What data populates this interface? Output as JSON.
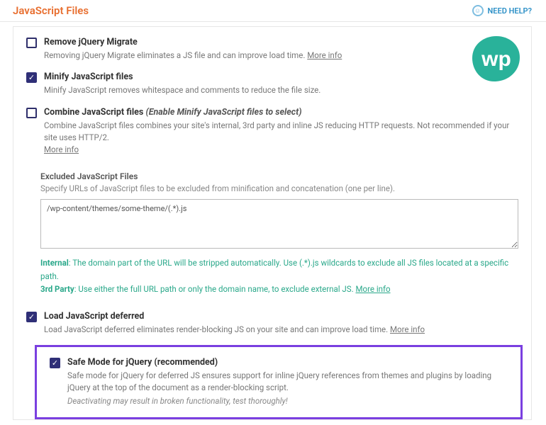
{
  "header": {
    "page_title": "JavaScript Files",
    "need_help": "NEED HELP?"
  },
  "options": {
    "remove_migrate": {
      "title": "Remove jQuery Migrate",
      "desc": "Removing jQuery Migrate eliminates a JS file and can improve load time.",
      "more_info": "More info"
    },
    "minify": {
      "title": "Minify JavaScript files",
      "desc": "Minify JavaScript removes whitespace and comments to reduce the file size."
    },
    "combine": {
      "title": "Combine JavaScript files",
      "qualifier": "(Enable Minify JavaScript files to select)",
      "desc": "Combine JavaScript files combines your site's internal, 3rd party and inline JS reducing HTTP requests. Not recommended if your site uses HTTP/2.",
      "more_info": "More info"
    },
    "excluded": {
      "title": "Excluded JavaScript Files",
      "desc": "Specify URLs of JavaScript files to be excluded from minification and concatenation (one per line).",
      "textarea_value": "/wp-content/themes/some-theme/(.*).js",
      "hint_internal_label": "Internal",
      "hint_internal": ": The domain part of the URL will be stripped automatically. Use (.*).js wildcards to exclude all JS files located at a specific path.",
      "hint_3rdparty_label": "3rd Party",
      "hint_3rdparty": ": Use either the full URL path or only the domain name, to exclude external JS.",
      "more_info": "More info"
    },
    "defer": {
      "title": "Load JavaScript deferred",
      "desc": "Load JavaScript deferred eliminates render-blocking JS on your site and can improve load time.",
      "more_info": "More info"
    },
    "safe_mode": {
      "title": "Safe Mode for jQuery (recommended)",
      "desc": "Safe mode for jQuery for deferred JS ensures support for inline jQuery references from themes and plugins by loading jQuery at the top of the document as a render-blocking script.",
      "warn": "Deactivating may result in broken functionality, test thoroughly!"
    }
  },
  "badge": {
    "text": "wp"
  }
}
